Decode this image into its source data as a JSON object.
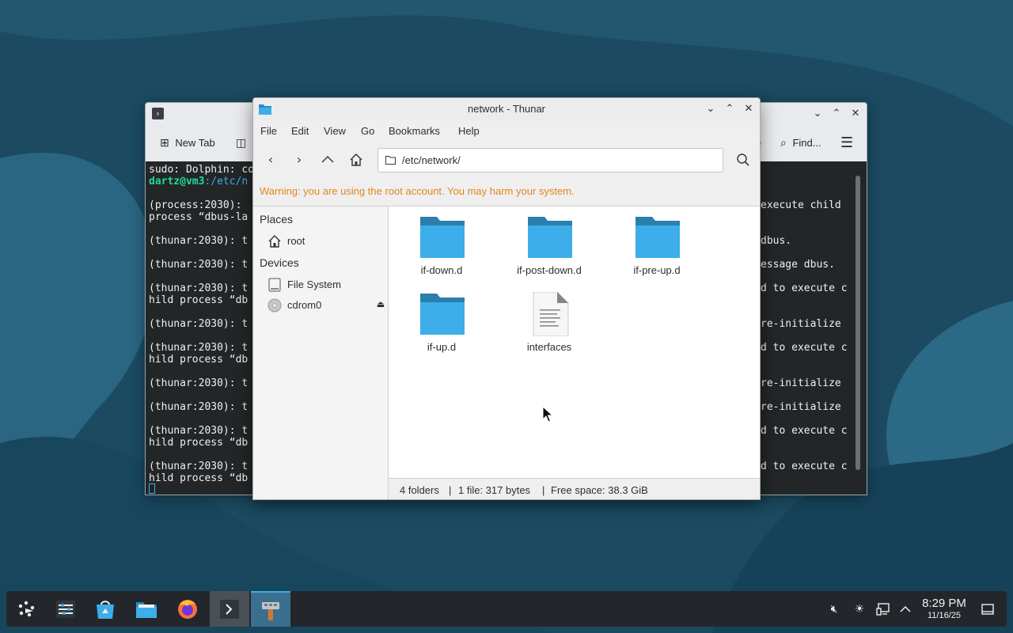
{
  "colors": {
    "wallpaper": "#1d4e66",
    "terminal_bg": "#232627",
    "terminal_user": "#1cdc9a",
    "terminal_path": "#3daee9",
    "warning": "#e5851a",
    "folder": "#3daee9",
    "taskbar": "#23272c",
    "accent": "#3daee9"
  },
  "konsole": {
    "toolbar": {
      "new_tab": "New Tab",
      "find": "Find...",
      "partial_right": "e"
    },
    "lines_left": [
      "sudo: Dolphin: co",
      "dartz@vm3:/etc/n",
      "",
      "(process:2030): ",
      "process “dbus-la",
      "",
      "(thunar:2030): t",
      "",
      "(thunar:2030): t",
      "",
      "(thunar:2030): t",
      "hild process “db",
      "",
      "(thunar:2030): t",
      "",
      "(thunar:2030): t",
      "hild process “db",
      "",
      "(thunar:2030): t",
      "",
      "(thunar:2030): t",
      "",
      "(thunar:2030): t",
      "hild process “db",
      "",
      "(thunar:2030): t",
      "hild process “db"
    ],
    "user_host": "dartz@vm3",
    "path_fragment": ":/etc/n",
    "lines_right": [
      {
        "row": 3,
        "text": "execute child"
      },
      {
        "row": 6,
        "text": "dbus."
      },
      {
        "row": 8,
        "text": "essage dbus."
      },
      {
        "row": 10,
        "text": "d to execute c"
      },
      {
        "row": 13,
        "text": "re-initialize"
      },
      {
        "row": 15,
        "text": "d to execute c"
      },
      {
        "row": 18,
        "text": "re-initialize"
      },
      {
        "row": 20,
        "text": "re-initialize"
      },
      {
        "row": 22,
        "text": "d to execute c"
      },
      {
        "row": 25,
        "text": "d to execute c"
      }
    ]
  },
  "thunar": {
    "title": "network - Thunar",
    "menu": [
      "File",
      "Edit",
      "View",
      "Go",
      "Bookmarks",
      "Help"
    ],
    "location": "/etc/network/",
    "warning": "Warning: you are using the root account. You may harm your system.",
    "sidebar": {
      "places_header": "Places",
      "places": [
        {
          "label": "root",
          "icon": "home-icon"
        }
      ],
      "devices_header": "Devices",
      "devices": [
        {
          "label": "File System",
          "icon": "drive-icon"
        },
        {
          "label": "cdrom0",
          "icon": "optical-disc-icon"
        }
      ]
    },
    "files": [
      {
        "name": "if-down.d",
        "type": "folder"
      },
      {
        "name": "if-post-down.d",
        "type": "folder"
      },
      {
        "name": "if-pre-up.d",
        "type": "folder"
      },
      {
        "name": "if-up.d",
        "type": "folder"
      },
      {
        "name": "interfaces",
        "type": "text-file"
      }
    ],
    "status": {
      "folders": "4 folders",
      "files": "1 file: 317 bytes",
      "free": "Free space: 38.3 GiB",
      "separator": "|"
    }
  },
  "taskbar": {
    "items": [
      "app-launcher-icon",
      "system-settings-icon",
      "discover-store-icon",
      "file-manager-icon",
      "firefox-icon",
      "konsole-icon",
      "thunar-icon"
    ],
    "tray": [
      "volume-muted-icon",
      "brightness-icon",
      "network-icon",
      "tray-expand-icon"
    ],
    "time": "8:29 PM",
    "date": "11/16/25"
  }
}
